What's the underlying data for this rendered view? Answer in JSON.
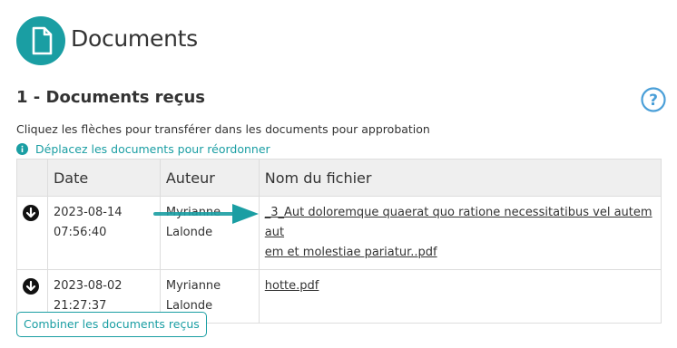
{
  "header": {
    "title": "Documents",
    "icon": "document-icon"
  },
  "section": {
    "title": "1 - Documents reçus",
    "help_icon": "help-icon"
  },
  "instruction": "Cliquez les flèches pour transférer dans les documents pour approbation",
  "info": {
    "icon": "info-icon",
    "text": "Déplacez les documents pour réordonner"
  },
  "table": {
    "columns": [
      "",
      "Date",
      "Auteur",
      "Nom du fichier"
    ],
    "rows": [
      {
        "action_icon": "arrow-down-circle-icon",
        "date": "2023-08-14",
        "time": "07:56:40",
        "author_first": "Myrianne",
        "author_last": "Lalonde",
        "file_line1": "_3_Aut doloremque quaerat quo ratione necessitatibus vel autem aut",
        "file_line2": "em et molestiae pariatur..pdf"
      },
      {
        "action_icon": "arrow-down-circle-icon",
        "date": "2023-08-02",
        "time": "21:27:37",
        "author_first": "Myrianne",
        "author_last": "Lalonde",
        "file_line1": "hotte.pdf",
        "file_line2": ""
      }
    ]
  },
  "combine_button": "Combiner les documents reçus",
  "colors": {
    "accent": "#1a9ea3",
    "header_bg": "#efefef",
    "help": "#4a9fd8",
    "annotation_arrow": "#1a9ea3"
  }
}
